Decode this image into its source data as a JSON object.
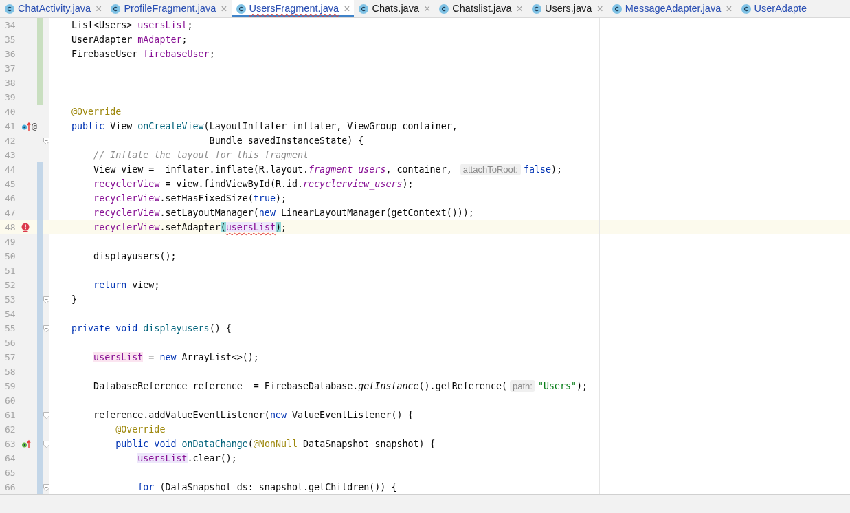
{
  "tabs": [
    {
      "label": "ChatActivity.java",
      "selected": false,
      "modified": true,
      "error": false,
      "close": "×"
    },
    {
      "label": "ProfileFragment.java",
      "selected": false,
      "modified": true,
      "error": false,
      "close": "×"
    },
    {
      "label": "UsersFragment.java",
      "selected": true,
      "modified": true,
      "error": true,
      "close": "×"
    },
    {
      "label": "Chats.java",
      "selected": false,
      "modified": false,
      "error": false,
      "close": "×"
    },
    {
      "label": "Chatslist.java",
      "selected": false,
      "modified": false,
      "error": false,
      "close": "×"
    },
    {
      "label": "Users.java",
      "selected": false,
      "modified": false,
      "error": false,
      "close": "×"
    },
    {
      "label": "MessageAdapter.java",
      "selected": false,
      "modified": true,
      "error": false,
      "close": "×"
    },
    {
      "label": "UserAdapte",
      "selected": false,
      "modified": true,
      "error": false
    }
  ],
  "editor": {
    "lines": [
      {
        "number": "34",
        "added": true,
        "changed": false,
        "segments": [
          {
            "kind": "code",
            "tokens": [
              {
                "kind": "plain",
                "text": "List<Users> "
              },
              {
                "kind": "field",
                "text": "usersList"
              },
              {
                "kind": "plain",
                "text": ";"
              }
            ]
          }
        ]
      },
      {
        "number": "35",
        "added": true,
        "changed": false,
        "segments": [
          {
            "kind": "code",
            "tokens": [
              {
                "kind": "plain",
                "text": "UserAdapter "
              },
              {
                "kind": "field",
                "text": "mAdapter"
              },
              {
                "kind": "plain",
                "text": ";"
              }
            ]
          }
        ]
      },
      {
        "number": "36",
        "added": true,
        "changed": false,
        "segments": [
          {
            "kind": "code",
            "tokens": [
              {
                "kind": "plain",
                "text": "FirebaseUser "
              },
              {
                "kind": "field",
                "text": "firebaseUser"
              },
              {
                "kind": "plain",
                "text": ";"
              }
            ]
          }
        ]
      },
      {
        "number": "37",
        "added": true,
        "changed": false
      },
      {
        "number": "38",
        "added": true,
        "changed": false
      },
      {
        "number": "39",
        "added": true,
        "changed": false
      },
      {
        "number": "40",
        "added": false,
        "changed": false,
        "segments": [
          {
            "kind": "code",
            "tokens": [
              {
                "kind": "annotation",
                "text": "@Override"
              }
            ]
          }
        ]
      },
      {
        "number": "41",
        "added": false,
        "changed": false,
        "gutter": [
          {
            "kind": "overrides"
          },
          {
            "kind": "glyph",
            "text": "@"
          }
        ],
        "segments": [
          {
            "kind": "code",
            "tokens": [
              {
                "kind": "keyword",
                "text": "public"
              },
              {
                "kind": "plain",
                "text": " View "
              },
              {
                "kind": "declaration",
                "text": "onCreateView"
              },
              {
                "kind": "plain",
                "text": "(LayoutInflater inflater, ViewGroup container,"
              }
            ]
          }
        ]
      },
      {
        "number": "42",
        "added": false,
        "changed": false,
        "fold": true,
        "segments": [
          {
            "kind": "code",
            "tokens": [
              {
                "kind": "plain",
                "text": "                         Bundle savedInstanceState) {"
              }
            ]
          }
        ]
      },
      {
        "number": "43",
        "added": false,
        "changed": false,
        "segments": [
          {
            "kind": "code",
            "tokens": [
              {
                "kind": "comment",
                "text": "    // Inflate the layout for this fragment"
              }
            ]
          }
        ]
      },
      {
        "number": "44",
        "added": false,
        "changed": true,
        "segments": [
          {
            "kind": "code",
            "tokens": [
              {
                "kind": "plain",
                "text": "    View view =  inflater.inflate(R.layout."
              },
              {
                "kind": "static",
                "text": "fragment_users"
              },
              {
                "kind": "plain",
                "text": ", container, "
              }
            ]
          },
          {
            "kind": "hint",
            "text": "attachToRoot:"
          },
          {
            "kind": "code",
            "tokens": [
              {
                "kind": "keyword",
                "text": "false"
              },
              {
                "kind": "plain",
                "text": ");"
              }
            ]
          }
        ]
      },
      {
        "number": "45",
        "added": false,
        "changed": true,
        "segments": [
          {
            "kind": "code",
            "tokens": [
              {
                "kind": "field",
                "text": "    recyclerView"
              },
              {
                "kind": "plain",
                "text": " = view.findViewById(R.id."
              },
              {
                "kind": "static",
                "text": "recyclerview_users"
              },
              {
                "kind": "plain",
                "text": ");"
              }
            ]
          }
        ]
      },
      {
        "number": "46",
        "added": false,
        "changed": true,
        "segments": [
          {
            "kind": "code",
            "tokens": [
              {
                "kind": "field",
                "text": "    recyclerView"
              },
              {
                "kind": "plain",
                "text": ".setHasFixedSize("
              },
              {
                "kind": "keyword",
                "text": "true"
              },
              {
                "kind": "plain",
                "text": ");"
              }
            ]
          }
        ]
      },
      {
        "number": "47",
        "added": false,
        "changed": true,
        "segments": [
          {
            "kind": "code",
            "tokens": [
              {
                "kind": "field",
                "text": "    recyclerView"
              },
              {
                "kind": "plain",
                "text": ".setLayoutManager("
              },
              {
                "kind": "keyword",
                "text": "new"
              },
              {
                "kind": "plain",
                "text": " LinearLayoutManager(getContext()));"
              }
            ]
          }
        ]
      },
      {
        "number": "48",
        "added": false,
        "changed": true,
        "current": true,
        "gutter": [
          {
            "kind": "error"
          }
        ],
        "segments": [
          {
            "kind": "code",
            "tokens": [
              {
                "kind": "field",
                "text": "    recyclerView"
              },
              {
                "kind": "plain",
                "text": ".setAdapter"
              },
              {
                "kind": "plain",
                "text": "(",
                "matched_brace": true
              },
              {
                "kind": "field",
                "text": "usersList",
                "error": true
              },
              {
                "kind": "plain",
                "text": ")",
                "matched_brace": true
              },
              {
                "kind": "plain",
                "text": ";"
              }
            ]
          }
        ]
      },
      {
        "number": "49",
        "added": false,
        "changed": true
      },
      {
        "number": "50",
        "added": false,
        "changed": true,
        "segments": [
          {
            "kind": "code",
            "tokens": [
              {
                "kind": "plain",
                "text": "    displayusers();"
              }
            ]
          }
        ]
      },
      {
        "number": "51",
        "added": false,
        "changed": true
      },
      {
        "number": "52",
        "added": false,
        "changed": true,
        "segments": [
          {
            "kind": "code",
            "tokens": [
              {
                "kind": "keyword",
                "text": "    return"
              },
              {
                "kind": "plain",
                "text": " view;"
              }
            ]
          }
        ]
      },
      {
        "number": "53",
        "added": false,
        "changed": true,
        "fold": true,
        "segments": [
          {
            "kind": "code",
            "tokens": [
              {
                "kind": "plain",
                "text": "}"
              }
            ]
          }
        ]
      },
      {
        "number": "54",
        "added": false,
        "changed": true
      },
      {
        "number": "55",
        "added": false,
        "changed": true,
        "fold": true,
        "segments": [
          {
            "kind": "code",
            "tokens": [
              {
                "kind": "keyword",
                "text": "private void "
              },
              {
                "kind": "declaration",
                "text": "displayusers"
              },
              {
                "kind": "plain",
                "text": "() {"
              }
            ]
          }
        ]
      },
      {
        "number": "56",
        "added": false,
        "changed": true
      },
      {
        "number": "57",
        "added": false,
        "changed": true,
        "segments": [
          {
            "kind": "code",
            "tokens": [
              {
                "kind": "field",
                "text": "    usersList",
                "write_usage": true
              },
              {
                "kind": "plain",
                "text": " = "
              },
              {
                "kind": "keyword",
                "text": "new"
              },
              {
                "kind": "plain",
                "text": " ArrayList<>();"
              }
            ]
          }
        ]
      },
      {
        "number": "58",
        "added": false,
        "changed": true
      },
      {
        "number": "59",
        "added": false,
        "changed": true,
        "segments": [
          {
            "kind": "code",
            "tokens": [
              {
                "kind": "plain",
                "text": "    DatabaseReference reference  = FirebaseDatabase."
              },
              {
                "kind": "italic",
                "text": "getInstance"
              },
              {
                "kind": "plain",
                "text": "().getReference("
              }
            ]
          },
          {
            "kind": "hint",
            "text": "path:"
          },
          {
            "kind": "code",
            "tokens": [
              {
                "kind": "string",
                "text": "\"Users\""
              },
              {
                "kind": "plain",
                "text": ");"
              }
            ]
          }
        ]
      },
      {
        "number": "60",
        "added": false,
        "changed": true
      },
      {
        "number": "61",
        "added": false,
        "changed": true,
        "fold": true,
        "segments": [
          {
            "kind": "code",
            "tokens": [
              {
                "kind": "plain",
                "text": "    reference.addValueEventListener("
              },
              {
                "kind": "keyword",
                "text": "new"
              },
              {
                "kind": "plain",
                "text": " ValueEventListener() {"
              }
            ]
          }
        ]
      },
      {
        "number": "62",
        "added": false,
        "changed": true,
        "segments": [
          {
            "kind": "code",
            "tokens": [
              {
                "kind": "annotation",
                "text": "        @Override"
              }
            ]
          }
        ]
      },
      {
        "number": "63",
        "added": false,
        "changed": true,
        "fold": true,
        "gutter": [
          {
            "kind": "implements"
          }
        ],
        "segments": [
          {
            "kind": "code",
            "tokens": [
              {
                "kind": "keyword",
                "text": "        public void "
              },
              {
                "kind": "declaration",
                "text": "onDataChange"
              },
              {
                "kind": "plain",
                "text": "("
              },
              {
                "kind": "annotation",
                "text": "@NonNull"
              },
              {
                "kind": "plain",
                "text": " DataSnapshot snapshot) {"
              }
            ]
          }
        ]
      },
      {
        "number": "64",
        "added": false,
        "changed": true,
        "segments": [
          {
            "kind": "code",
            "tokens": [
              {
                "kind": "field",
                "text": "            usersList",
                "read_usage": true
              },
              {
                "kind": "plain",
                "text": ".clear();"
              }
            ]
          }
        ]
      },
      {
        "number": "65",
        "added": false,
        "changed": true
      },
      {
        "number": "66",
        "added": false,
        "changed": true,
        "fold": true,
        "segments": [
          {
            "kind": "code",
            "tokens": [
              {
                "kind": "keyword",
                "text": "            for"
              },
              {
                "kind": "plain",
                "text": " (DataSnapshot ds: snapshot.getChildren()) {"
              }
            ]
          }
        ]
      }
    ]
  }
}
